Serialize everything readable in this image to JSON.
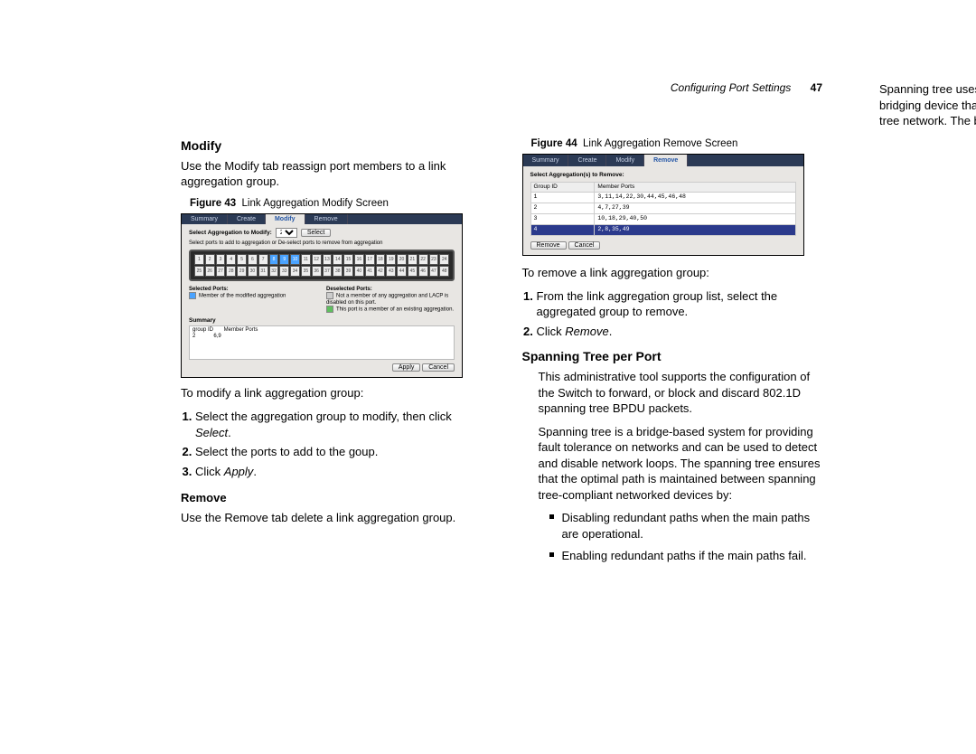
{
  "header": {
    "running_title": "Configuring Port Settings",
    "page_number": "47"
  },
  "section_modify": {
    "heading": "Modify",
    "intro": "Use the Modify tab reassign port members to a link aggregation group.",
    "fig_label": "Figure 43",
    "fig_title": "Link Aggregation Modify Screen",
    "fig": {
      "tabs": [
        "Summary",
        "Create",
        "Modify",
        "Remove"
      ],
      "select_label": "Select Aggregation to Modify:",
      "select_value": "2",
      "select_btn": "Select",
      "instruction": "Select ports to add to aggregation or De-select ports to remove from aggregation",
      "selected_ports_hdr": "Selected Ports:",
      "deselected_ports_hdr": "Deselected Ports:",
      "legend_sel": "Member of the modified aggregation",
      "legend_des1": "Not a member of any aggregation and LACP is disabled on this port.",
      "legend_des2": "This port is a member of an existing aggregation.",
      "summary_hdr": "Summary",
      "summary_cols": "group ID       Member Ports",
      "summary_row": "2            6,9",
      "apply_btn": "Apply",
      "cancel_btn": "Cancel",
      "port_top": [
        "1",
        "2",
        "3",
        "4",
        "5",
        "6",
        "7",
        "8",
        "9",
        "10",
        "11",
        "12",
        "13",
        "14",
        "15",
        "16",
        "17",
        "18",
        "19",
        "20",
        "21",
        "22",
        "23",
        "24"
      ],
      "port_bot": [
        "25",
        "26",
        "27",
        "28",
        "29",
        "30",
        "31",
        "32",
        "33",
        "34",
        "35",
        "36",
        "37",
        "38",
        "39",
        "40",
        "41",
        "42",
        "43",
        "44",
        "45",
        "46",
        "47",
        "48"
      ],
      "selected_idx": [
        8,
        9,
        10
      ]
    },
    "after_fig": "To modify a link aggregation group:",
    "steps": [
      "Select the aggregation group to modify, then click <em>Select</em>.",
      "Select the ports to add to the goup.",
      "Click <em>Apply</em>."
    ]
  },
  "section_remove": {
    "heading": "Remove",
    "intro": "Use the Remove tab delete a link aggregation group.",
    "fig_label": "Figure 44",
    "fig_title": "Link Aggregation Remove Screen",
    "fig": {
      "tabs": [
        "Summary",
        "Create",
        "Modify",
        "Remove"
      ],
      "sel_title": "Select Aggregation(s) to Remove:",
      "th1": "Group ID",
      "th2": "Member Ports",
      "rows": [
        {
          "gid": "1",
          "mp": "3,11,14,22,30,44,45,46,48"
        },
        {
          "gid": "2",
          "mp": "4,7,27,39"
        },
        {
          "gid": "3",
          "mp": "10,18,29,40,50"
        },
        {
          "gid": "4",
          "mp": "2,8,35,49"
        }
      ],
      "remove_btn": "Remove",
      "cancel_btn": "Cancel"
    },
    "after_fig": "To remove a link aggregation group:",
    "steps": [
      "From the link aggregation group list, select the aggregated group to remove.",
      "Click <em>Remove</em>."
    ]
  },
  "section_stp": {
    "heading": "Spanning Tree per Port",
    "p1": "This administrative tool supports the configuration of the Switch to forward, or block and discard 802.1D spanning tree BPDU packets.",
    "p2": "Spanning tree is a bridge-based system for providing fault tolerance on networks and can be used to detect and disable network loops. The spanning tree ensures that the optimal path is maintained between spanning tree-compliant networked devices by:",
    "bullets": [
      "Disabling redundant paths when the main paths are operational.",
      "Enabling redundant paths if the main paths fail."
    ],
    "p3": "Spanning tree uses a distributed algorithm to select a bridging device that serves as the root of the spanning tree network. The bridging device known as"
  }
}
